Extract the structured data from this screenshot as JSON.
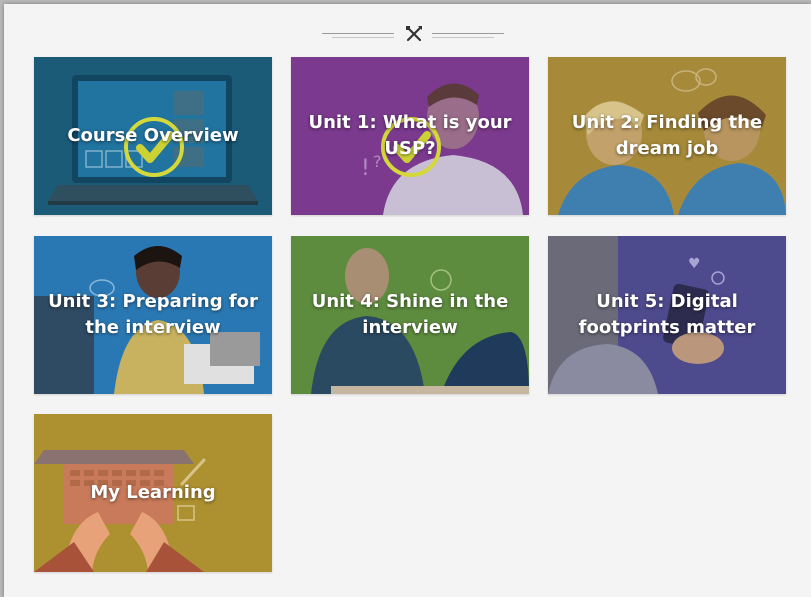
{
  "header": {
    "icon": "pencil-ruler-icon"
  },
  "tiles": [
    {
      "title": "Course Overview",
      "completed": true,
      "color": "#1b5b78",
      "icon": "checkmark-icon"
    },
    {
      "title": "Unit 1: What is your USP?",
      "completed": true,
      "color": "#7b3a8e",
      "icon": "checkmark-icon"
    },
    {
      "title": "Unit 2: Finding the dream job",
      "completed": false,
      "color": "#a68a3a"
    },
    {
      "title": "Unit 3: Preparing for the interview",
      "completed": false,
      "color": "#2a78b3"
    },
    {
      "title": "Unit 4: Shine in the interview",
      "completed": false,
      "color": "#5e8c3f"
    },
    {
      "title": "Unit 5: Digital footprints matter",
      "completed": false,
      "color": "#4e4a8e"
    },
    {
      "title": "My Learning",
      "completed": false,
      "color": "#ad9030"
    }
  ],
  "colors": {
    "check_ring": "#d4d83a",
    "check_mark": "#cdd234",
    "background": "#f4f4f4"
  }
}
